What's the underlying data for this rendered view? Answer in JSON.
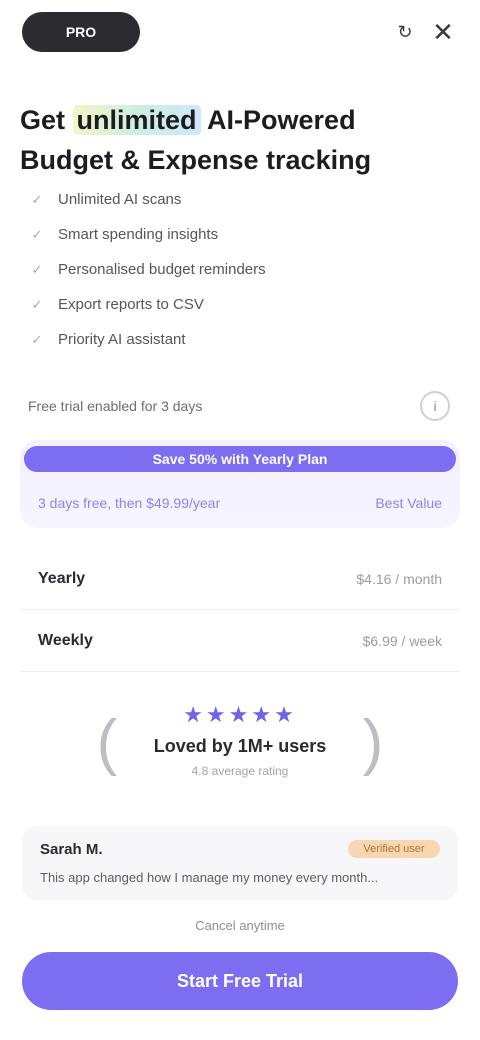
{
  "header": {
    "badge_label": "PRO",
    "restore_icon": "refresh-icon",
    "close_icon": "close-icon",
    "restore_glyph": "↻",
    "close_glyph": "✕"
  },
  "headline": {
    "before": "Get",
    "highlight": "unlimited",
    "after": "AI-Powered Budget & Expense tracking"
  },
  "features": [
    {
      "icon": "check-icon",
      "label": "Unlimited AI scans"
    },
    {
      "icon": "check-icon",
      "label": "Smart spending insights"
    },
    {
      "icon": "check-icon",
      "label": "Personalised budget reminders"
    },
    {
      "icon": "check-icon",
      "label": "Export reports to CSV"
    },
    {
      "icon": "check-icon",
      "label": "Priority AI assistant"
    }
  ],
  "toggle_row": {
    "label": "Free trial enabled for 3 days",
    "info_glyph": "i"
  },
  "plans": {
    "active_label": "Save 50% with Yearly Plan",
    "left_label": "3 days free, then $49.99/year",
    "right_label": "Best Value"
  },
  "options": [
    {
      "name": "Yearly",
      "price": "$4.16 / month"
    },
    {
      "name": "Weekly",
      "price": "$6.99 / week"
    }
  ],
  "rating": {
    "stars": "★★★★★",
    "title": "Loved by 1M+ users",
    "subtitle": "4.8 average rating",
    "laurel_left": "(",
    "laurel_right": ")"
  },
  "review": {
    "author": "Sarah M.",
    "badge": "Verified user",
    "quote": "This app changed how I manage my money every month..."
  },
  "footer": {
    "trial_note": "Cancel anytime",
    "cta_label": "Start Free Trial"
  },
  "colors": {
    "accent": "#7d6df0",
    "dark_pill": "#2b2b30"
  }
}
